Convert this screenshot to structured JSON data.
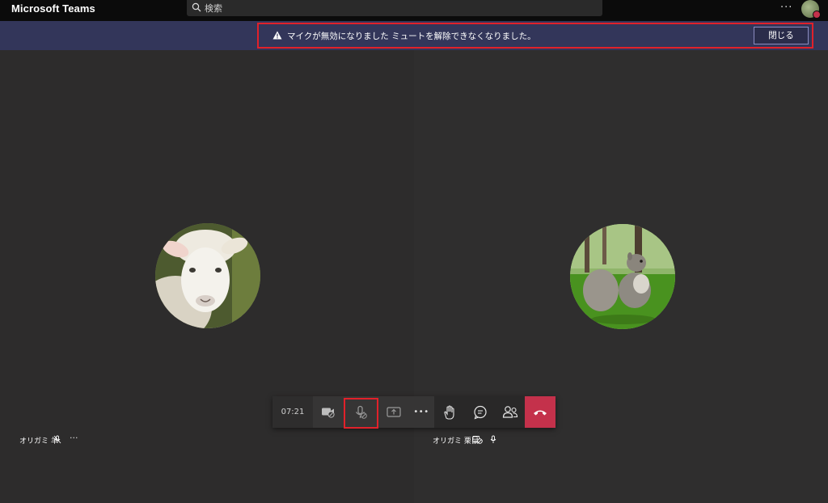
{
  "app": {
    "title": "Microsoft Teams"
  },
  "search": {
    "placeholder": "検索"
  },
  "header": {
    "more_label": "···"
  },
  "banner": {
    "message": "マイクが無効になりました ミュートを解除できなくなりました。",
    "close_label": "閉じる"
  },
  "participants": [
    {
      "name": "オリガミ 羊",
      "more_label": "···",
      "picture": "sheep"
    },
    {
      "name": "オリガミ 栗鼠",
      "picture": "squirrel"
    }
  ],
  "controls": {
    "timer": "07:21",
    "more_label": "•••",
    "icons": [
      "camera-off-icon",
      "mic-disabled-icon",
      "share-screen-icon",
      "more-icon",
      "raise-hand-icon",
      "chat-icon",
      "participants-icon",
      "hang-up-icon"
    ]
  },
  "colors": {
    "background": "#2d2c2c",
    "banner": "#33365a",
    "highlight": "#e1212a",
    "hangup": "#c4314b"
  }
}
